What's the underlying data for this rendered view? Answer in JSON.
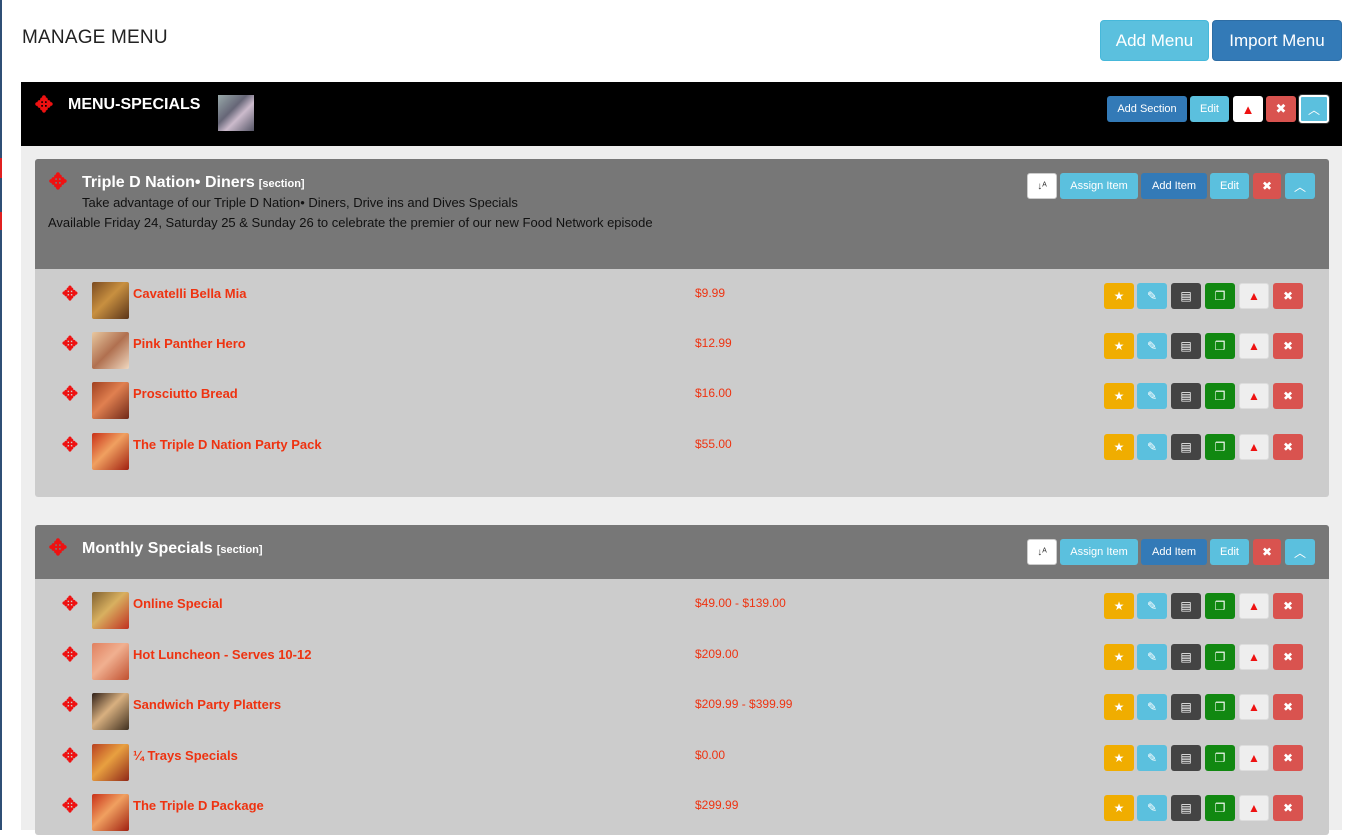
{
  "page_title": "MANAGE MENU",
  "top_buttons": {
    "add_menu": "Add Menu",
    "import_menu": "Import Menu"
  },
  "menu": {
    "title": "MENU-SPECIALS",
    "buttons": {
      "add_section": "Add Section",
      "edit": "Edit"
    }
  },
  "section_buttons": {
    "assign_item": "Assign Item",
    "add_item": "Add Item",
    "edit": "Edit"
  },
  "sections": [
    {
      "title": "Triple D Nation• Diners",
      "tag": "[section]",
      "description_line1": "Take advantage of our Triple D Nation• Diners, Drive ins and Dives Specials",
      "description_line2": "Available Friday 24, Saturday 25 & Sunday 26 to celebrate the premier of our new Food Network episode",
      "items": [
        {
          "name": "Cavatelli Bella Mia",
          "price": "$9.99"
        },
        {
          "name": "Pink Panther Hero",
          "price": "$12.99"
        },
        {
          "name": "Prosciutto Bread",
          "price": "$16.00"
        },
        {
          "name": "The Triple D Nation Party Pack",
          "price": "$55.00"
        }
      ]
    },
    {
      "title": "Monthly Specials",
      "tag": "[section]",
      "items": [
        {
          "name": "Online Special",
          "price": "$49.00 - $139.00"
        },
        {
          "name": "Hot Luncheon - Serves 10-12",
          "price": "$209.00"
        },
        {
          "name": "Sandwich Party Platters",
          "price": "$209.99 - $399.99"
        },
        {
          "name": "¼ Trays Specials",
          "price": "$0.00"
        },
        {
          "name": "The Triple D Package",
          "price": "$299.99"
        }
      ]
    }
  ],
  "icons": {
    "move": "move-arrows-icon",
    "sort": "sort-alpha-icon",
    "star": "star-icon",
    "edit": "edit-icon",
    "details": "list-icon",
    "copy": "copy-icon",
    "warn": "warning-icon",
    "delete": "close-icon",
    "collapse": "chevron-up-icon"
  }
}
